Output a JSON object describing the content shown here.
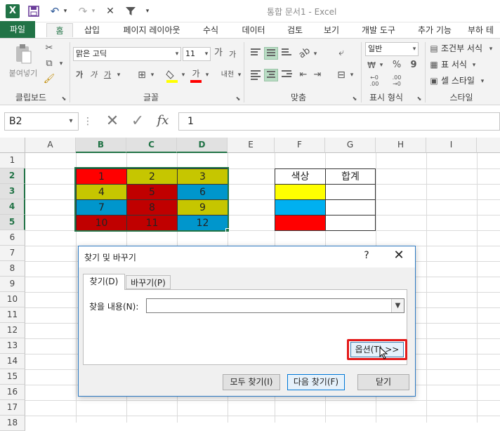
{
  "titlebar": {
    "app_icon": "X",
    "doc_title": "통합 문서1 - Excel",
    "save_icon": "save-icon",
    "undo_icon": "undo-icon",
    "redo_icon": "redo-icon",
    "close_x": "✕",
    "filter_icon": "filter-icon"
  },
  "ribbon_tabs": [
    "파일",
    "홈",
    "삽입",
    "페이지 레이아웃",
    "수식",
    "데이터",
    "검토",
    "보기",
    "개발 도구",
    "추가 기능",
    "부하 테"
  ],
  "ribbon": {
    "paste_label": "붙여넣기",
    "font_name": "맑은 고딕",
    "font_size": "11",
    "grow_font": "가",
    "shrink_font": "가",
    "bold": "가",
    "italic": "가",
    "underline": "가",
    "font_color_letter": "가",
    "wrap_label": "내천",
    "number_format": "일반",
    "currency": "₩",
    "percent": "%",
    "comma": "9",
    "conditional": "조건부 서식",
    "table_format": "표 서식",
    "cell_style": "셀 스타일",
    "groups": {
      "clipboard": "클립보드",
      "font": "글꼴",
      "align": "맞춤",
      "number": "표시 형식",
      "style": "스타일"
    }
  },
  "formula_bar": {
    "name_box": "B2",
    "more": "⋮",
    "cancel": "✕",
    "enter": "✓",
    "fx": "fx",
    "value": "1"
  },
  "columns": [
    "A",
    "B",
    "C",
    "D",
    "E",
    "F",
    "G",
    "H",
    "I"
  ],
  "rows": [
    "1",
    "2",
    "3",
    "4",
    "5",
    "6",
    "7",
    "8",
    "9",
    "10",
    "11",
    "12",
    "13",
    "14",
    "15",
    "16",
    "17",
    "18"
  ],
  "table_values": [
    [
      "1",
      "2",
      "3"
    ],
    [
      "4",
      "5",
      "6"
    ],
    [
      "7",
      "8",
      "9"
    ],
    [
      "10",
      "11",
      "12"
    ]
  ],
  "table_colors": [
    [
      "#ff0000",
      "#c6c600",
      "#c6c600"
    ],
    [
      "#c6c600",
      "#c00000",
      "#0096cc"
    ],
    [
      "#0096cc",
      "#c00000",
      "#c6c600"
    ],
    [
      "#c00000",
      "#c00000",
      "#0096cc"
    ]
  ],
  "legend": {
    "header_color": "색상",
    "header_total": "합계",
    "swatches": [
      "#ffff00",
      "#00b0f0",
      "#ff0000"
    ]
  },
  "dialog": {
    "title": "찾기 및 바꾸기",
    "help": "?",
    "close": "✕",
    "tab_find": "찾기(D)",
    "tab_replace": "바꾸기(P)",
    "find_label": "찾을 내용(N):",
    "find_value": "",
    "options_button": "옵션(T) >>",
    "find_all": "모두 찾기(I)",
    "find_next": "다음 찾기(F)",
    "close_button": "닫기"
  }
}
